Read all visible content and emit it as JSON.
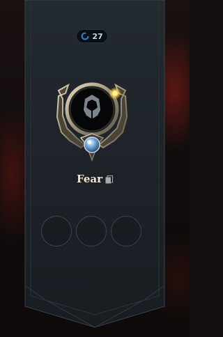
{
  "counter": {
    "icon": "refresh-ring-icon",
    "value": "27"
  },
  "emblem": {
    "icon": "helmet-icon",
    "accent_color": "#ffd24a",
    "gem_color": "#6fa6d8"
  },
  "champion": {
    "name": "Fear",
    "icon": "document-icon"
  },
  "slots": [
    {
      "state": "empty"
    },
    {
      "state": "empty"
    },
    {
      "state": "empty"
    }
  ],
  "colors": {
    "banner": "#1f252b",
    "banner_border": "#3a424b",
    "ring": "#c9b68a",
    "name_text": "#f0e6d2"
  }
}
